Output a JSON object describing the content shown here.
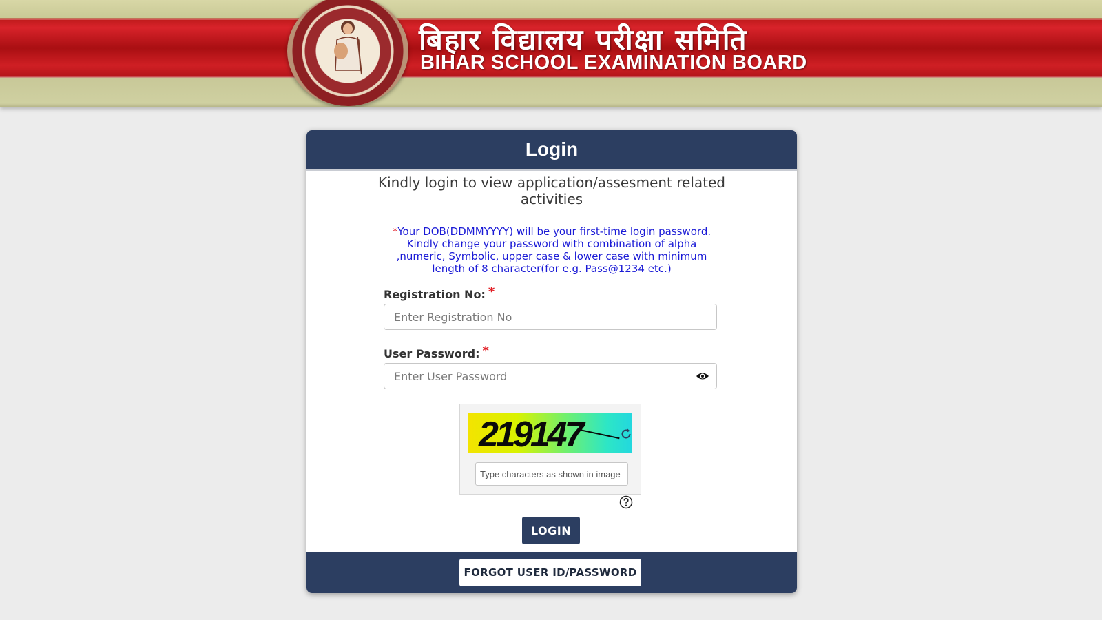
{
  "banner": {
    "title_hindi": "बिहार विद्यालय परीक्षा समिति",
    "title_english": "BIHAR SCHOOL EXAMINATION BOARD"
  },
  "login": {
    "title": "Login",
    "subtitle": "Kindly login to view application/assesment related activities",
    "note_marker": "*",
    "note": "Your DOB(DDMMYYYY) will be your first-time login password. Kindly change your password with combination of alpha ,numeric, Symbolic, upper case & lower case with minimum length of 8 character(for e.g. Pass@1234 etc.)",
    "registration_label": "Registration No:",
    "registration_placeholder": "Enter Registration No",
    "registration_value": "",
    "password_label": "User Password:",
    "password_placeholder": "Enter User Password",
    "password_value": "",
    "required_marker": "*",
    "captcha_code": "219147",
    "captcha_placeholder": "Type characters as shown in image",
    "captcha_value": "",
    "login_button": "LOGIN",
    "forgot_button": "FORGOT USER ID/PASSWORD"
  },
  "colors": {
    "primary": "#2c3e61",
    "note_text": "#1a1ad6",
    "required": "#e21f26",
    "banner_red": "#c8171d"
  }
}
